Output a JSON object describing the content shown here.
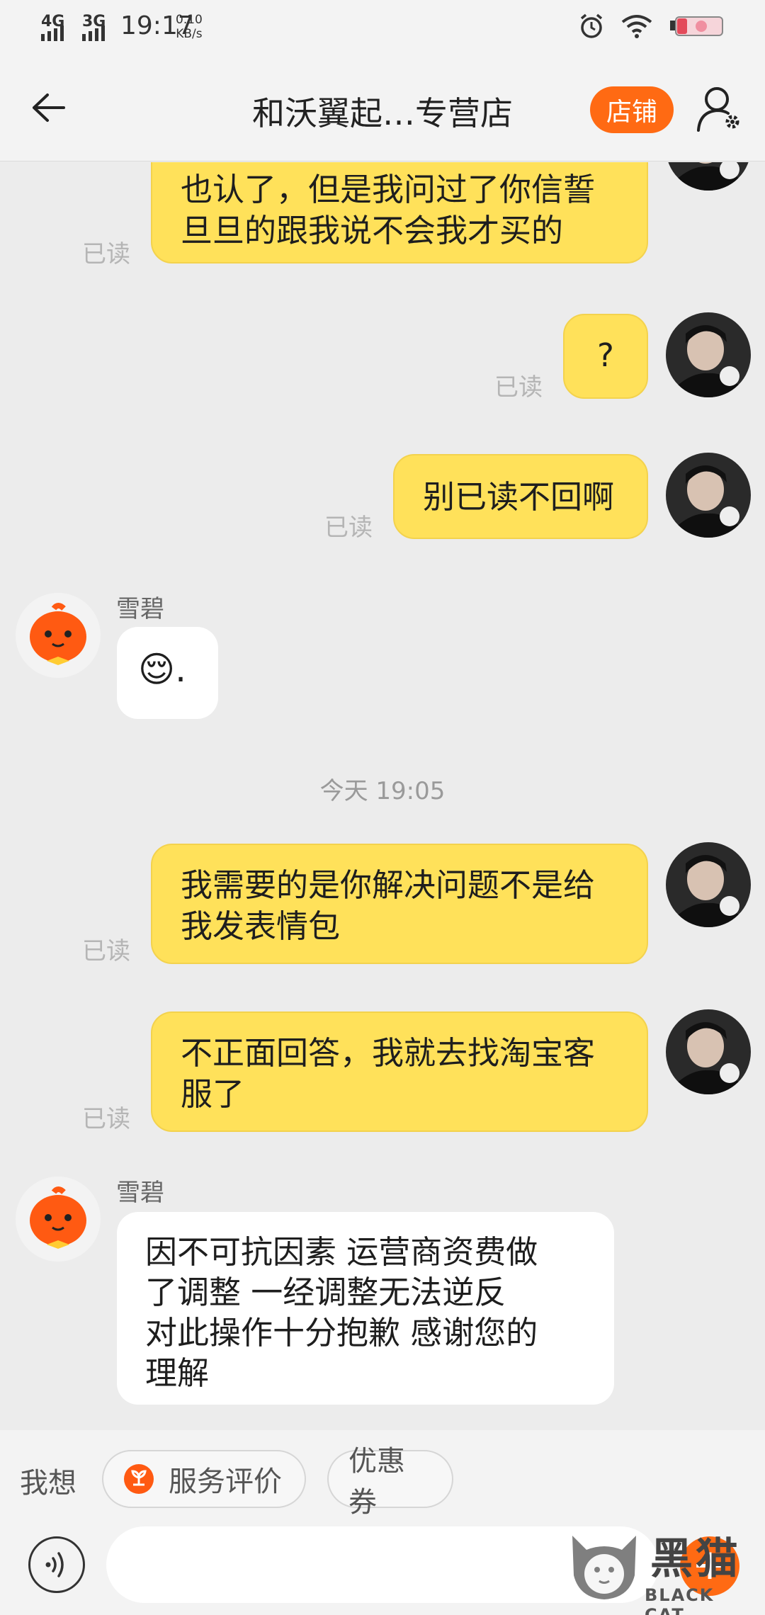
{
  "status_bar": {
    "network1": "4G",
    "network2": "3G",
    "time": "19:17",
    "speed_value": "0.10",
    "speed_unit": "KB/s"
  },
  "header": {
    "title": "和沃翼起…专营店",
    "shop_label": "店铺"
  },
  "messages": {
    "m1": {
      "text_line1": "也认了，但是我问过了你信誓",
      "text_line2": "旦旦的跟我说不会我才买的",
      "read": "已读"
    },
    "m2": {
      "text": "?",
      "read": "已读"
    },
    "m3": {
      "text": "别已读不回啊",
      "read": "已读"
    },
    "m4": {
      "sender": "雪碧",
      "text": "😌."
    },
    "timestamp": "今天 19:05",
    "m5": {
      "text_line1": "我需要的是你解决问题不是给",
      "text_line2": "我发表情包",
      "read": "已读"
    },
    "m6": {
      "text_line1": "不正面回答，我就去找淘宝客",
      "text_line2": "服了",
      "read": "已读"
    },
    "m7": {
      "sender": "雪碧",
      "line1": "因不可抗因素  运营商资费做",
      "line2": "了调整  一经调整无法逆反",
      "line3": "对此操作十分抱歉 感谢您的",
      "line4": "理解"
    }
  },
  "quick_bar": {
    "label": "我想",
    "chip1": "服务评价",
    "chip2": "优惠券"
  },
  "input": {
    "placeholder": ""
  },
  "watermark": {
    "cn": "黑猫",
    "en": "BLACK CAT"
  },
  "colors": {
    "accent": "#ff6a13",
    "outgoing_bubble": "#ffe15a",
    "incoming_bubble": "#ffffff",
    "background": "#ececec"
  },
  "icons": [
    "back-arrow-icon",
    "alarm-icon",
    "wifi-icon",
    "battery-icon",
    "person-settings-icon",
    "voice-icon",
    "plus-icon",
    "service-rating-icon"
  ]
}
